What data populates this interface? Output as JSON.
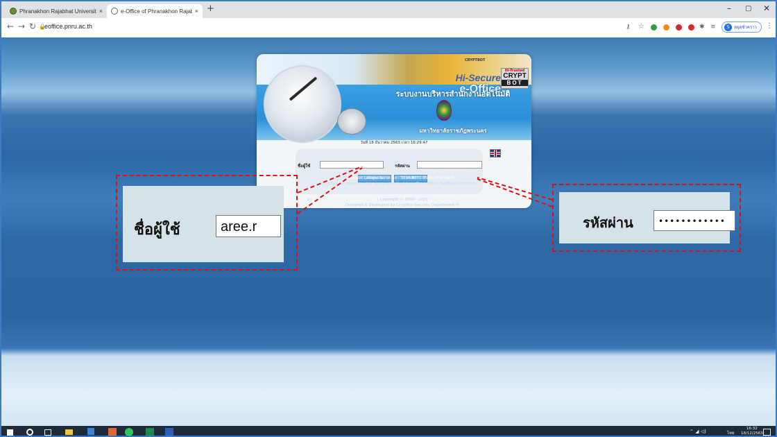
{
  "browser": {
    "tabs": [
      {
        "label": "Phranakhon Rajabhat University",
        "active": false
      },
      {
        "label": "e-Office of Phranakhon Rajabha",
        "active": true
      }
    ],
    "new_tab": "+",
    "close_glyph": "×",
    "url": "eoffice.pnru.ac.th",
    "profile_initial": "S",
    "profile_label": "หยุดชั่วคราว",
    "window_controls": {
      "minimize": "–",
      "maximize": "▢",
      "close": "✕"
    }
  },
  "panel": {
    "cryptbot_small": "CRYPTBOT",
    "hi_trusted": "Hi-Trusted",
    "crypt": "CRYPT",
    "bot": "BOT",
    "hi_secure": "Hi-Secure",
    "eoffice": "e-Office",
    "title": "ระบบงานบริหารสำนักงานอัตโนมัติ",
    "university": "มหาวิทยาลัยราชภัฏพระนคร",
    "datetime": "วันที่ 18 ธันวาคม 2563   เวลา 16:29:47",
    "username_label": "ชื่อผู้ใช้",
    "password_label": "รหัสผ่าน",
    "login_button": "เข้าสู่ระบบ",
    "cancel_button": "ยกเลิก"
  },
  "license": {
    "line1": "CryptBot License Serial No : 3614-4001-9526-2999-9626",
    "line2": "This license serial number was granted solely to Phranakhon Rajabhat University."
  },
  "copyright": {
    "line1_prefix": "by",
    "line1_product": "CryptBot Hi-Secure e-Office™",
    "line1_mid": "Copyright © 2000 - 2020",
    "line1_company": "Max Savings (Thailand) Co.,Ltd.",
    "line2": "Designed & Developed by CryptBot Security Department ®"
  },
  "zoom": {
    "username_label": "ชื่อผู้ใช้",
    "username_value": "aree.r",
    "password_label": "รหัสผ่าน",
    "password_value": "••••••••••••"
  },
  "taskbar": {
    "time": "16:32",
    "date": "18/12/2563",
    "lang": "ไทย"
  }
}
